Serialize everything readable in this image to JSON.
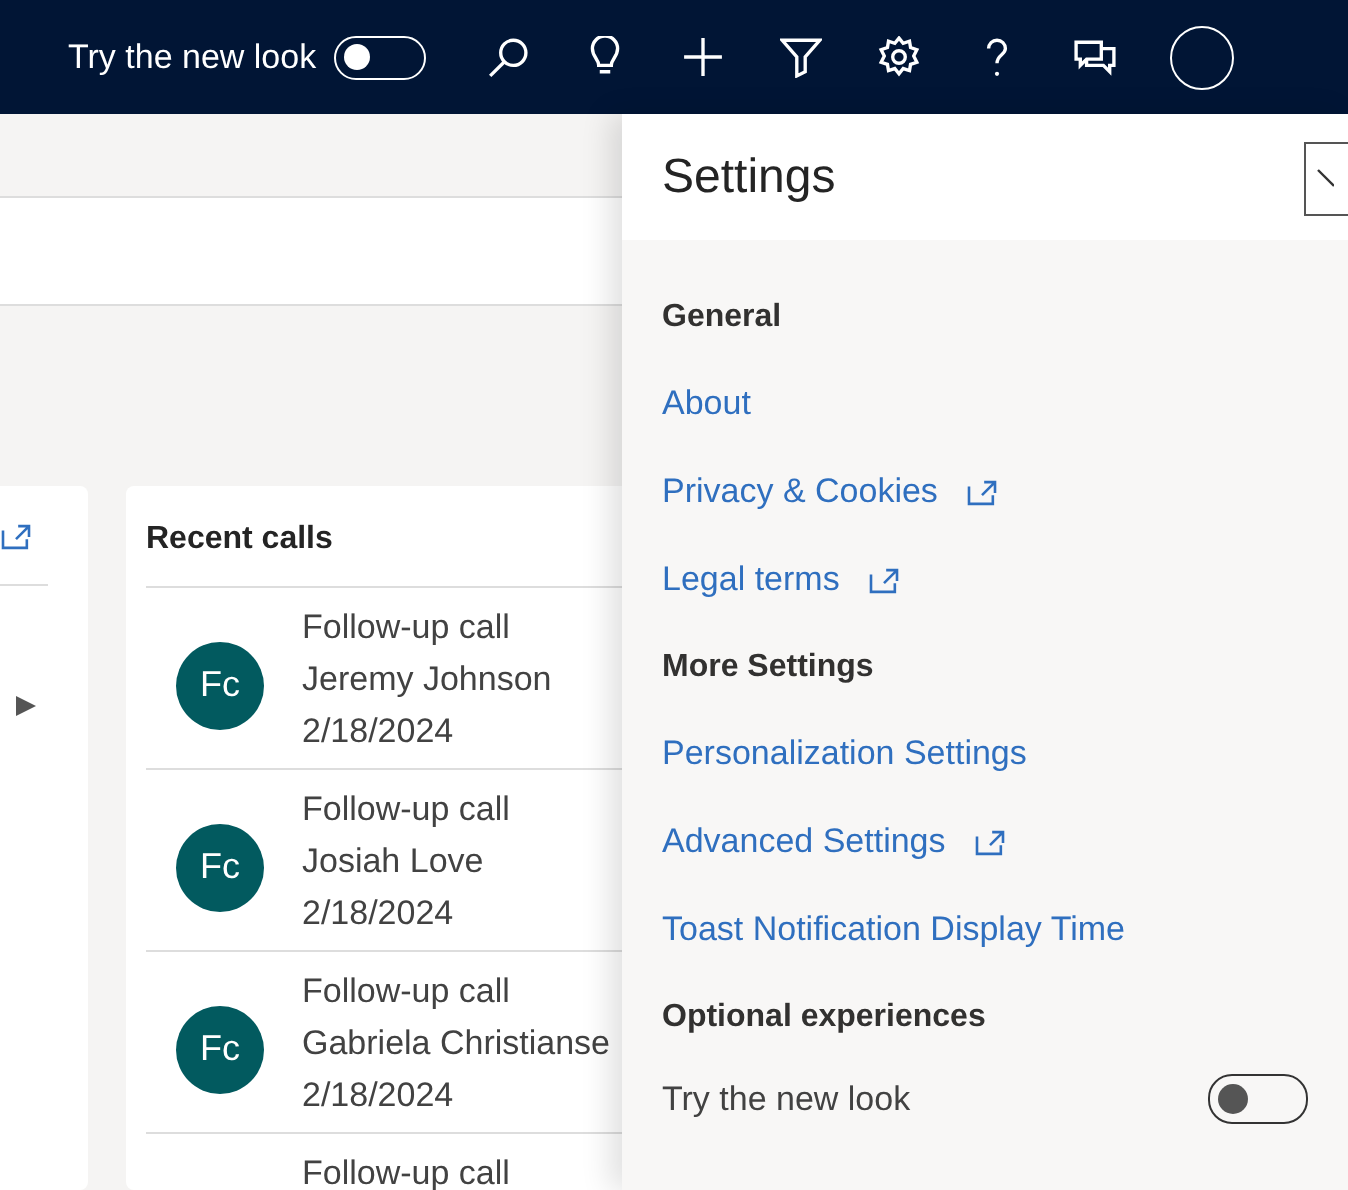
{
  "top_bar": {
    "toggle": {
      "label": "Try the new look",
      "on": false
    }
  },
  "recent_calls": {
    "title": "Recent calls",
    "items": [
      {
        "initials": "Fc",
        "subject": "Follow-up call",
        "contact": "Jeremy Johnson",
        "date": "2/18/2024"
      },
      {
        "initials": "Fc",
        "subject": "Follow-up call",
        "contact": "Josiah Love",
        "date": "2/18/2024"
      },
      {
        "initials": "Fc",
        "subject": "Follow-up call",
        "contact": "Gabriela Christianse",
        "date": "2/18/2024"
      },
      {
        "subject": "Follow-up call"
      }
    ]
  },
  "settings": {
    "title": "Settings",
    "sections": [
      {
        "heading": "General",
        "links": [
          {
            "label": "About",
            "external": false
          },
          {
            "label": "Privacy & Cookies",
            "external": true
          },
          {
            "label": "Legal terms",
            "external": true
          }
        ]
      },
      {
        "heading": "More Settings",
        "links": [
          {
            "label": "Personalization Settings",
            "external": false
          },
          {
            "label": "Advanced Settings",
            "external": true
          },
          {
            "label": "Toast Notification Display Time",
            "external": false
          }
        ]
      },
      {
        "heading": "Optional experiences",
        "toggles": [
          {
            "label": "Try the new look",
            "on": false
          }
        ]
      }
    ]
  }
}
